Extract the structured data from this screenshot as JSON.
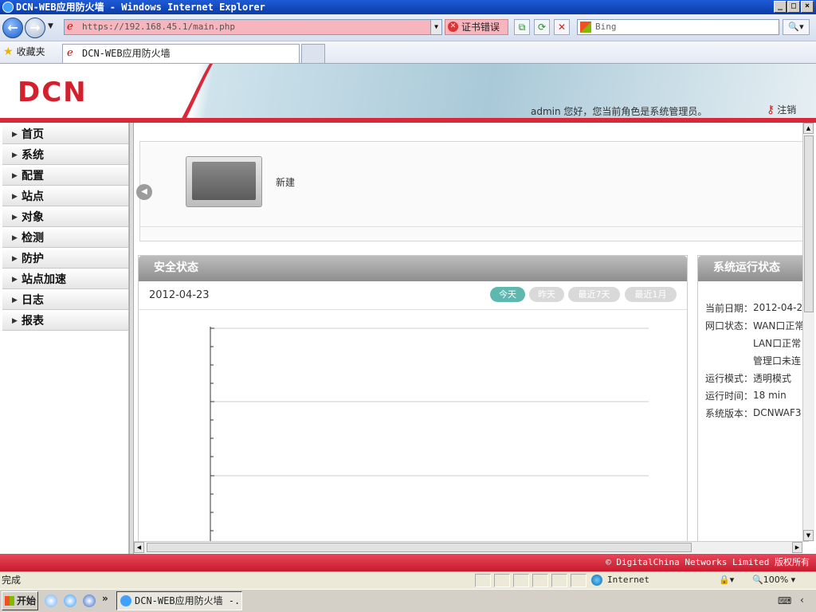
{
  "window": {
    "title": "DCN-WEB应用防火墙 - Windows Internet Explorer"
  },
  "browser": {
    "url": "https://192.168.45.1/main.php",
    "cert_error": "证书错误",
    "search_placeholder": "Bing",
    "favorites_label": "收藏夹",
    "tab_title": "DCN-WEB应用防火墙"
  },
  "header": {
    "logo": "DCN",
    "welcome": "admin 您好，您当前角色是系统管理员。",
    "logout": "注销"
  },
  "sidebar": {
    "items": [
      {
        "label": "首页"
      },
      {
        "label": "系统"
      },
      {
        "label": "配置"
      },
      {
        "label": "站点"
      },
      {
        "label": "对象"
      },
      {
        "label": "检测"
      },
      {
        "label": "防护"
      },
      {
        "label": "站点加速"
      },
      {
        "label": "日志"
      },
      {
        "label": "报表"
      }
    ]
  },
  "top_panel": {
    "new_label": "新建"
  },
  "security": {
    "title": "安全状态",
    "date": "2012-04-23",
    "ranges": [
      "今天",
      "昨天",
      "最近7天",
      "最近1月"
    ]
  },
  "system": {
    "title": "系统运行状态",
    "rows": [
      {
        "label": "当前日期：",
        "value": "2012-04-2"
      },
      {
        "label": "网口状态：",
        "value": "WAN口正常"
      },
      {
        "label": "",
        "value": "LAN口正常"
      },
      {
        "label": "",
        "value": "管理口未连"
      },
      {
        "label": "运行模式：",
        "value": "透明模式"
      },
      {
        "label": "运行时间：",
        "value": "18 min"
      },
      {
        "label": "系统版本：",
        "value": "DCNWAF3"
      }
    ]
  },
  "footer": {
    "copyright": "© DigitalChina Networks Limited 版权所有"
  },
  "status": {
    "done": "完成",
    "zone": "Internet",
    "zoom": "100%"
  },
  "taskbar": {
    "start": "开始",
    "task": "DCN-WEB应用防火墙 -..."
  },
  "colors": {
    "brand_red": "#d8283a",
    "accent_teal": "#5fb8b0"
  }
}
